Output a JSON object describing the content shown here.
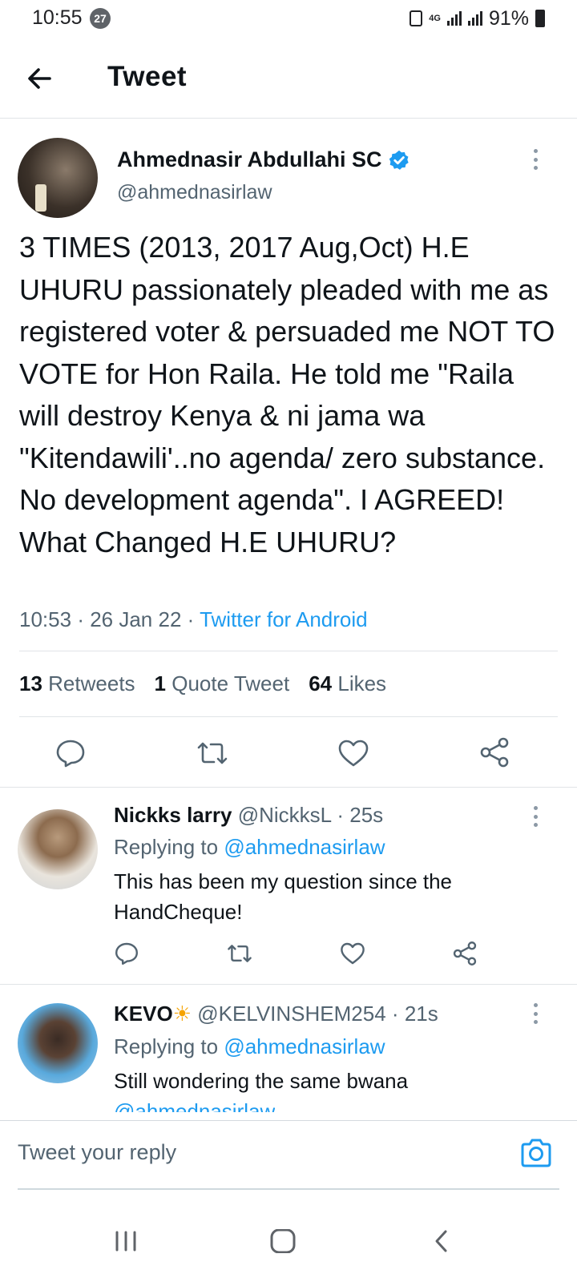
{
  "status_bar": {
    "time": "10:55",
    "notification_count": "27",
    "network": "4G",
    "battery": "91%"
  },
  "header": {
    "title": "Tweet"
  },
  "tweet": {
    "author_name": "Ahmednasir Abdullahi SC",
    "author_handle": "@ahmednasirlaw",
    "text": "3 TIMES (2013, 2017 Aug,Oct) H.E UHURU passionately pleaded with me as registered voter & persuaded me NOT TO VOTE for Hon Raila. He told me \"Raila will destroy Kenya & ni jama wa \"Kitendawili'..no agenda/ zero substance. No development agenda\". I AGREED! What Changed H.E UHURU?",
    "time": "10:53",
    "date": "26 Jan 22",
    "source": "Twitter for Android",
    "retweets_count": "13",
    "retweets_label": "Retweets",
    "quotes_count": "1",
    "quotes_label": "Quote Tweet",
    "likes_count": "64",
    "likes_label": "Likes",
    "accent_color": "#1d9bf0"
  },
  "replies": [
    {
      "name": "Nickks larry",
      "handle": "@NickksL",
      "age": "25s",
      "replying_label": "Replying to",
      "replying_to": "@ahmednasirlaw",
      "text": "This has been my question since the HandCheque!"
    },
    {
      "name": "KEVO",
      "emoji": "☀",
      "handle": "@KELVINSHEM254",
      "age": "21s",
      "replying_label": "Replying to",
      "replying_to": "@ahmednasirlaw",
      "text": "Still wondering the same bwana",
      "text_cut": "@ahmednasirlaw"
    }
  ],
  "reply_bar": {
    "placeholder": "Tweet your reply"
  }
}
